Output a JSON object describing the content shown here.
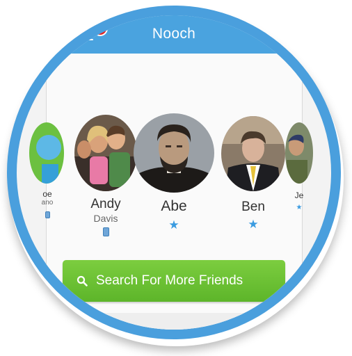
{
  "app": {
    "title": "Nooch",
    "notification_count": "1",
    "accent_color": "#4aa3df",
    "button_color": "#6cc235"
  },
  "friends": [
    {
      "first": "oe",
      "last": "ano",
      "icon": "device-icon"
    },
    {
      "first": "Andy",
      "last": "Davis",
      "icon": "device-icon"
    },
    {
      "first": "Abe",
      "last": "",
      "icon": "star-icon"
    },
    {
      "first": "Ben",
      "last": "",
      "icon": "star-icon"
    },
    {
      "first": "Je",
      "last": "",
      "icon": "star-icon"
    }
  ],
  "search": {
    "label": "Search For More Friends",
    "icon": "search-icon"
  }
}
